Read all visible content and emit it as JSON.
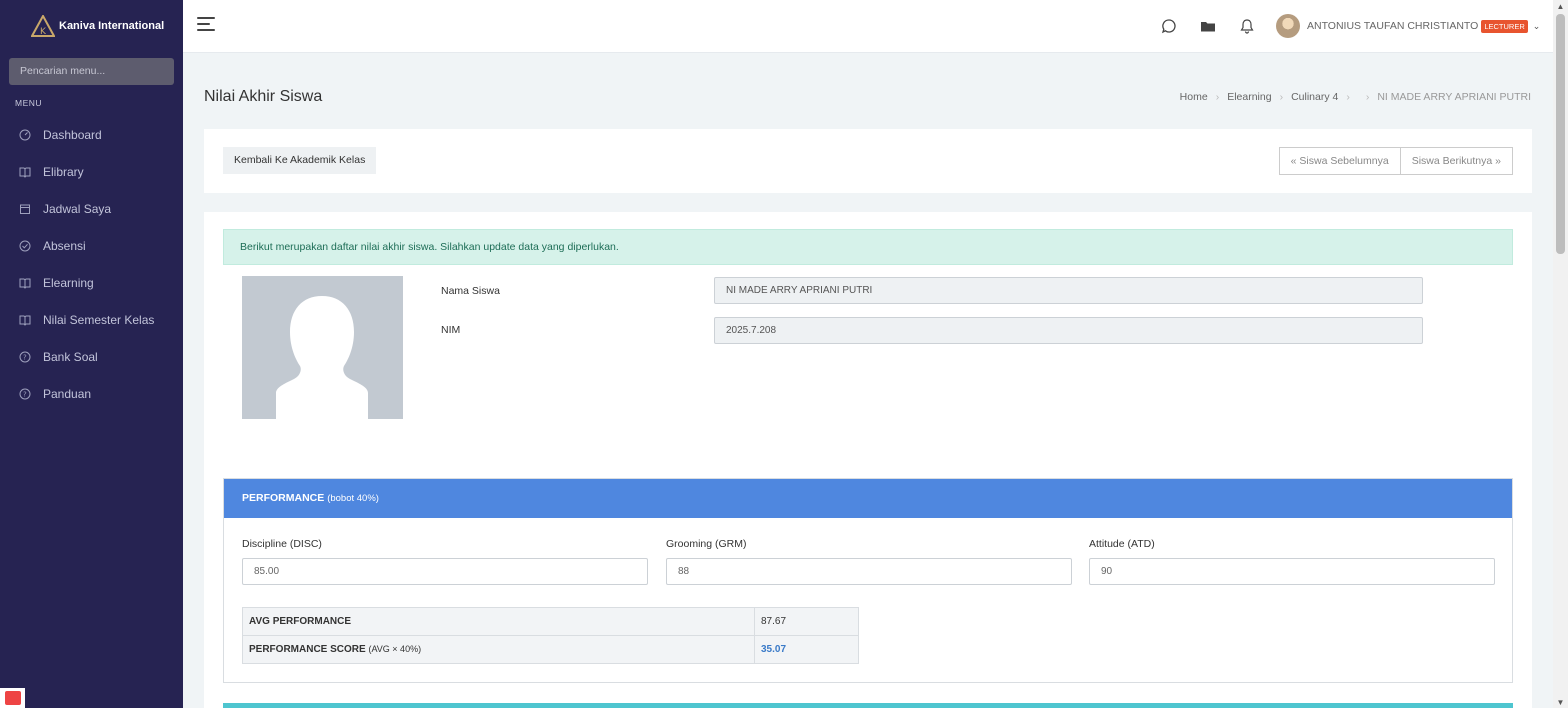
{
  "app": {
    "brand": "Kaniva International",
    "search_placeholder": "Pencarian menu...",
    "menu_heading": "MENU",
    "menu_items": [
      {
        "label": "Dashboard",
        "icon": "gauge-icon"
      },
      {
        "label": "Elibrary",
        "icon": "book-icon"
      },
      {
        "label": "Jadwal Saya",
        "icon": "calendar-icon"
      },
      {
        "label": "Absensi",
        "icon": "check-circle-icon"
      },
      {
        "label": "Elearning",
        "icon": "book-icon"
      },
      {
        "label": "Nilai Semester Kelas",
        "icon": "book-icon"
      },
      {
        "label": "Bank Soal",
        "icon": "question-circle-icon"
      },
      {
        "label": "Panduan",
        "icon": "question-circle-icon"
      }
    ]
  },
  "topbar": {
    "user_name": "ANTONIUS TAUFAN CHRISTIANTO",
    "user_role": "LECTURER"
  },
  "page": {
    "title": "Nilai Akhir Siswa",
    "breadcrumb": [
      "Home",
      "Elearning",
      "Culinary 4",
      "",
      "NI MADE ARRY APRIANI PUTRI"
    ]
  },
  "actions": {
    "back": "Kembali Ke Akademik Kelas",
    "prev": "« Siswa Sebelumnya",
    "next": "Siswa Berikutnya »"
  },
  "alert": "Berikut merupakan daftar nilai akhir siswa. Silahkan update data yang diperlukan.",
  "student": {
    "name_label": "Nama Siswa",
    "name_value": "NI MADE ARRY APRIANI PUTRI",
    "nim_label": "NIM",
    "nim_value": "2025.7.208"
  },
  "performance": {
    "title": "PERFORMANCE",
    "weight": "(bobot 40%)",
    "fields": [
      {
        "label": "Discipline (DISC)",
        "value": "85.00"
      },
      {
        "label": "Grooming (GRM)",
        "value": "88"
      },
      {
        "label": "Attitude (ATD)",
        "value": "90"
      }
    ],
    "avg_label": "AVG PERFORMANCE",
    "avg_value": "87.67",
    "score_label": "PERFORMANCE SCORE",
    "score_note": "(AVG × 40%)",
    "score_value": "35.07"
  },
  "colors": {
    "sidebar": "#262352",
    "accent": "#4f87df",
    "badge": "#e8542f",
    "alert_bg": "#d6f2ea",
    "teal": "#4ec5cf"
  }
}
